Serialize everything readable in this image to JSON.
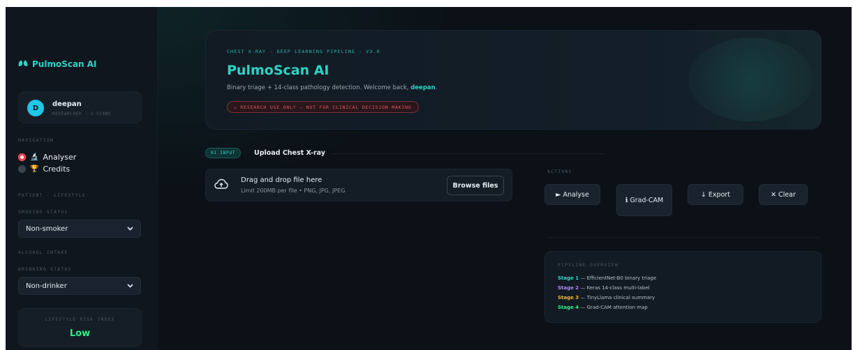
{
  "sidebar": {
    "brand": "PulmoScan AI",
    "user": {
      "initial": "D",
      "name": "deepan",
      "role": "RESEARCHER · 2 SCANS"
    },
    "navigation_label": "NAVIGATION",
    "nav_items": [
      {
        "label": "Analyser",
        "icon": "microscope-icon",
        "selected": true
      },
      {
        "label": "Credits",
        "icon": "trophy-icon",
        "selected": false
      }
    ],
    "patient_label": "PATIENT · LIFESTYLE",
    "smoking": {
      "label": "SMOKING STATUS",
      "value": "Non-smoker"
    },
    "alcohol_label": "ALCOHOL INTAKE",
    "drinking": {
      "label": "DRINKING STATUS",
      "value": "Non-drinker"
    },
    "risk": {
      "label": "LIFESTYLE RISK INDEX",
      "value": "Low"
    }
  },
  "hero": {
    "kicker": "CHEST X-RAY · DEEP LEARNING PIPELINE · V3.0",
    "title": "PulmoScan AI",
    "subtitle_prefix": "Binary triage + 14-class pathology detection. Welcome back, ",
    "subtitle_user": "deepan",
    "subtitle_suffix": ".",
    "warning": "⚠ RESEARCH USE ONLY — NOT FOR CLINICAL DECISION MAKING"
  },
  "upload": {
    "badge": "01 INPUT",
    "title": "Upload Chest X-ray",
    "drop_title": "Drag and drop file here",
    "drop_sub": "Limit 200MB per file • PNG, JPG, JPEG",
    "browse_label": "Browse files"
  },
  "actions": {
    "label": "ACTIONS",
    "analyse": "► Analyse",
    "gradcam": "ℹ Grad-CAM",
    "export": "↓ Export",
    "clear": "✕ Clear"
  },
  "pipeline": {
    "title": "PIPELINE OVERVIEW",
    "stages": [
      {
        "name": "Stage 1",
        "desc": " — EfficientNet-B0 binary triage",
        "color": "#35d8c9"
      },
      {
        "name": "Stage 2",
        "desc": " — Keras 14-class multi-label",
        "color": "#b08cf5"
      },
      {
        "name": "Stage 3",
        "desc": " — TinyLlama clinical summary",
        "color": "#f4b63c"
      },
      {
        "name": "Stage 4",
        "desc": " — Grad-CAM attention map",
        "color": "#2ef08c"
      }
    ]
  },
  "colors": {
    "accent": "#2ed3c6",
    "background": "#0b1117",
    "warning": "#e35a64",
    "risk_low": "#2ef08c"
  }
}
